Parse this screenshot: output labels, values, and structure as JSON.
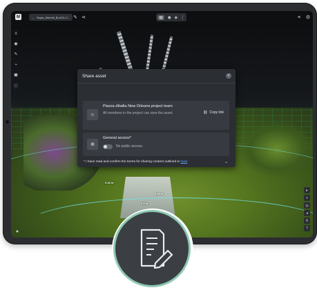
{
  "toolbar": {
    "logo": "M",
    "file_name": "Sepia_Wetmill_BLACK-V...",
    "back_icon": "arrow-left-icon",
    "tool_icons": [
      "ruler-icon",
      "share-icon"
    ],
    "view_modes": [
      "grid",
      "3d",
      "layers",
      "more"
    ]
  },
  "modal": {
    "title": "Share asset",
    "team": {
      "name": "Piazza dItailia New Orleans project team",
      "description": "All members in the project can view the asset.",
      "copy_link_label": "Copy link"
    },
    "general_access": {
      "title": "General access*",
      "toggle_label": "No public access."
    },
    "terms_text": "* I have read and confirm the terms for sharing content outlined in",
    "terms_link": "here",
    "terms_suffix": "."
  },
  "scene_labels": [
    "0.46 m",
    "0.2 m",
    "0.36 m"
  ],
  "colors": {
    "modal_bg": "#2b2e33",
    "card_bg": "#373b41",
    "link": "#62a8ff",
    "badge_ring": "#8fc9b3",
    "badge_bg": "#3b3f44"
  }
}
